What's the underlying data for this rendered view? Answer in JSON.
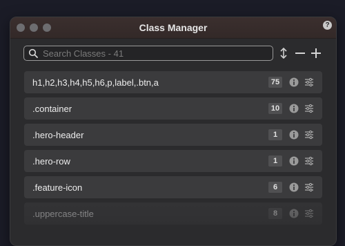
{
  "window": {
    "title": "Class Manager",
    "help_label": "?"
  },
  "search": {
    "placeholder": "Search Classes - 41",
    "value": ""
  },
  "toolbar": {
    "sort_icon": "sort-icon",
    "remove_icon": "minus-icon",
    "add_icon": "plus-icon"
  },
  "classes": [
    {
      "name": "h1,h2,h3,h4,h5,h6,p,label,.btn,a",
      "count": "75"
    },
    {
      "name": ".container",
      "count": "10"
    },
    {
      "name": ".hero-header",
      "count": "1"
    },
    {
      "name": ".hero-row",
      "count": "1"
    },
    {
      "name": ".feature-icon",
      "count": "6"
    },
    {
      "name": ".uppercase-title",
      "count": "8"
    }
  ],
  "colors": {
    "background": "#1b1c27",
    "panel": "#2b2b2d",
    "row": "#3b3b3d",
    "titlebar": "#3b2f2e"
  }
}
